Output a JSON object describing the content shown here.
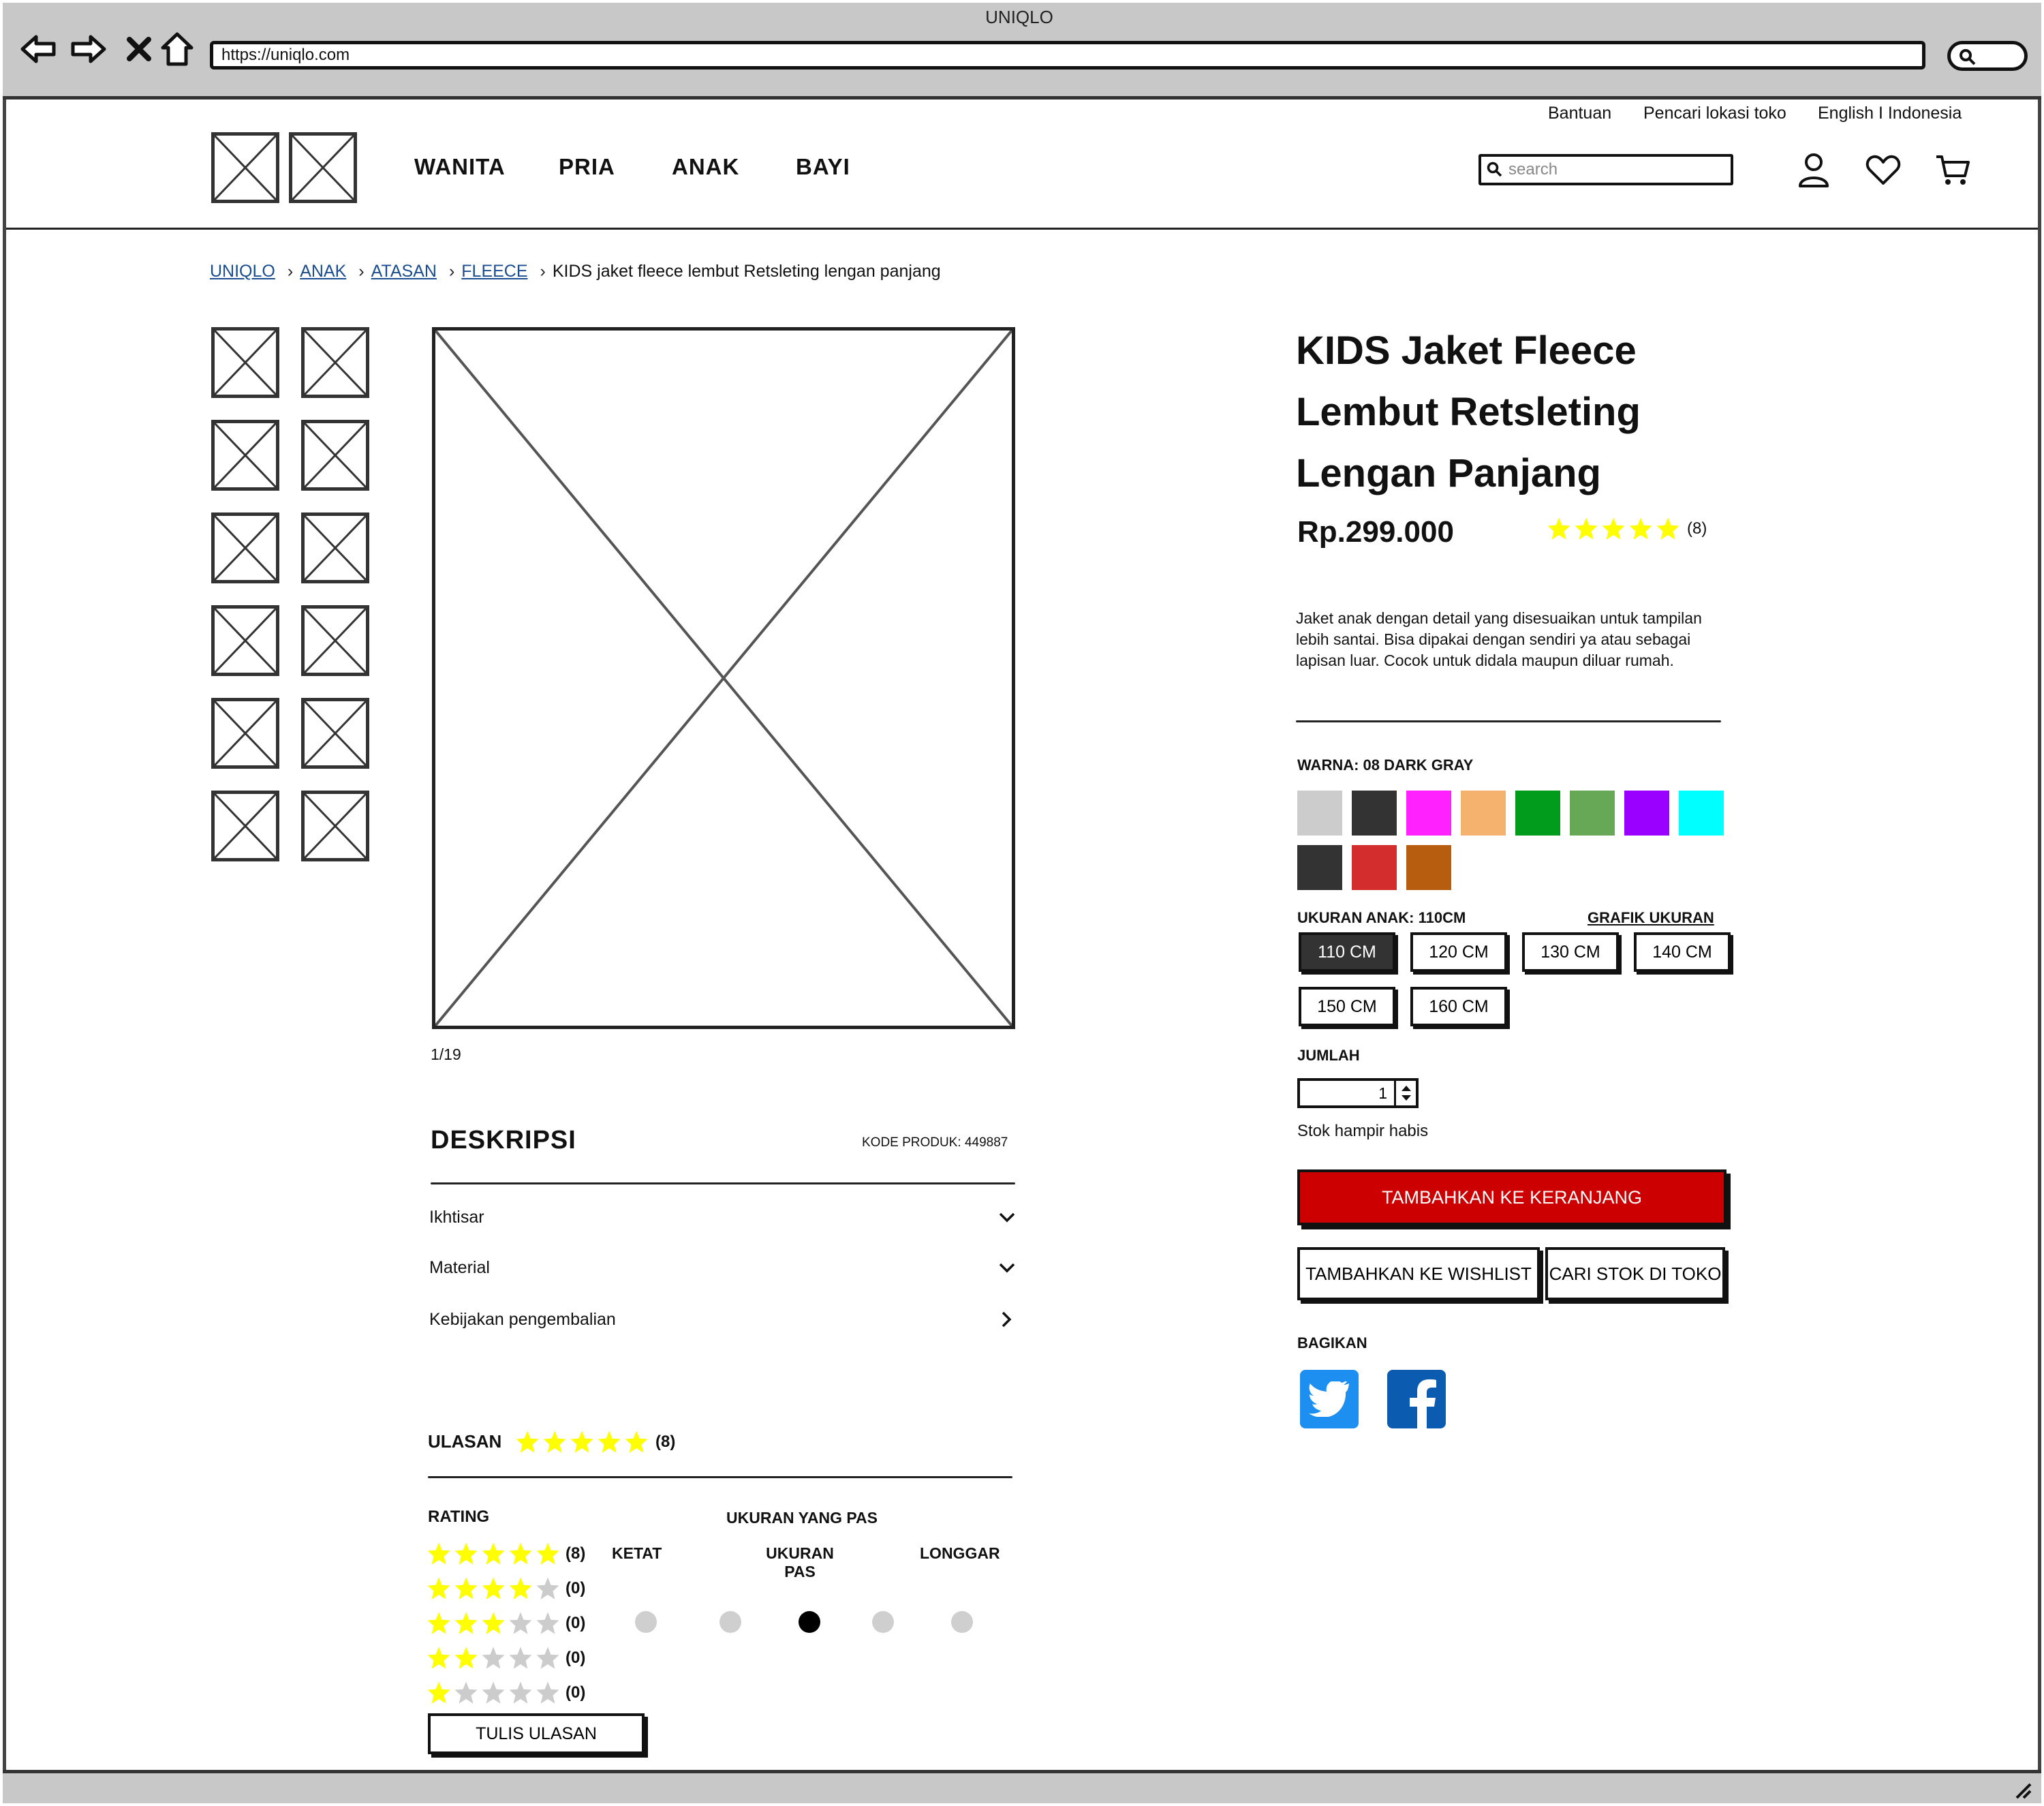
{
  "browser": {
    "window_title": "UNIQLO",
    "url": "https://uniqlo.com"
  },
  "header": {
    "util_links": [
      "Bantuan",
      "Pencari lokasi toko",
      "English I Indonesia"
    ],
    "categories": [
      "WANITA",
      "PRIA",
      "ANAK",
      "BAYI"
    ],
    "search_placeholder": "search",
    "icons": [
      "user-icon",
      "heart-icon",
      "cart-icon"
    ]
  },
  "breadcrumb": {
    "items": [
      "UNIQLO",
      "ANAK",
      "ATASAN",
      "FLEECE"
    ],
    "current": "KIDS jaket fleece lembut Retsleting lengan panjang"
  },
  "gallery": {
    "counter": "1/19"
  },
  "description": {
    "heading": "DESKRIPSI",
    "product_code": "KODE PRODUK: 449887",
    "items": [
      "Ikhtisar",
      "Material",
      "Kebijakan pengembalian"
    ]
  },
  "reviews": {
    "heading": "ULASAN",
    "count": "(8)",
    "stars": 5,
    "rating_title": "RATING",
    "rating_rows": [
      {
        "stars": 5,
        "count": "(8)"
      },
      {
        "stars": 4,
        "count": "(0)"
      },
      {
        "stars": 3,
        "count": "(0)"
      },
      {
        "stars": 2,
        "count": "(0)"
      },
      {
        "stars": 1,
        "count": "(0)"
      }
    ],
    "fit_title": "UKURAN YANG PAS",
    "fit_labels": [
      "KETAT",
      "UKURAN PAS",
      "LONGGAR"
    ],
    "fit_selected_index": 2,
    "fit_points": 5,
    "write_review": "TULIS ULASAN"
  },
  "product": {
    "title": "KIDS Jaket Fleece Lembut Retsleting Lengan Panjang",
    "price": "Rp.299.000",
    "stars": 5,
    "rating_count": "(8)",
    "description": "Jaket anak dengan detail yang disesuaikan untuk tampilan lebih santai. Bisa dipakai dengan sendiri ya atau sebagai lapisan luar. Cocok untuk didala maupun diluar rumah.",
    "color_label": "WARNA: 08 DARK GRAY",
    "colors": [
      "#cccccc",
      "#333333",
      "#ff22ff",
      "#f4b26e",
      "#019c1b",
      "#66a855",
      "#9a00ff",
      "#00ffff",
      "#333333",
      "#d32d2d",
      "#b75d0f"
    ],
    "size_label": "UKURAN ANAK: 110CM",
    "size_chart": "GRAFIK UKURAN",
    "sizes": [
      "110 CM",
      "120 CM",
      "130 CM",
      "140 CM",
      "150 CM",
      "160 CM"
    ],
    "selected_size_index": 0,
    "qty_label": "JUMLAH",
    "qty_value": "1",
    "stock_status": "Stok hampir habis",
    "add_to_cart": "TAMBAHKAN KE KERANJANG",
    "wishlist": "TAMBAHKAN KE WISHLIST",
    "find_store": "CARI STOK DI TOKO",
    "share_label": "BAGIKAN",
    "share_icons": [
      "twitter-icon",
      "facebook-icon"
    ],
    "star_color": "#ffff00",
    "cart_button_color": "#cc0000"
  }
}
